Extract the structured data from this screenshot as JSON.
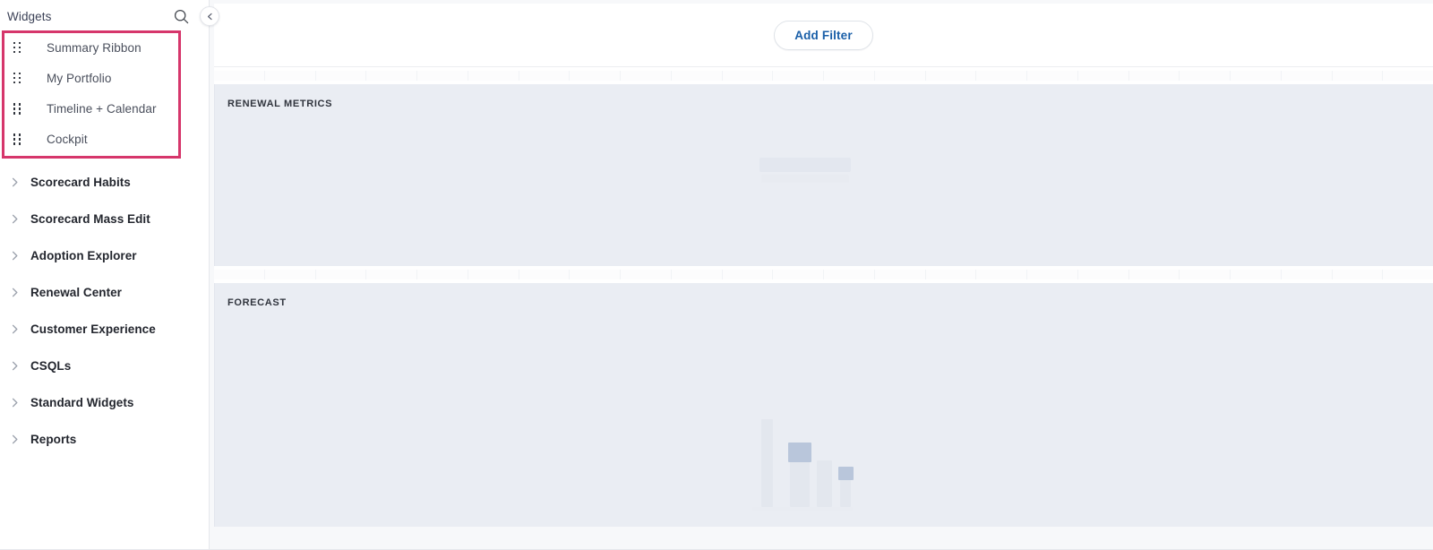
{
  "sidebar": {
    "title": "Widgets",
    "search_icon": "search-icon",
    "collapse_icon": "chevron-left-icon",
    "widgets": [
      {
        "label": "Summary Ribbon",
        "handle_icon": "drag-handle-icon"
      },
      {
        "label": "My Portfolio",
        "handle_icon": "drag-handle-icon"
      },
      {
        "label": "Timeline + Calendar",
        "handle_icon": "drag-handle-icon"
      },
      {
        "label": "Cockpit",
        "handle_icon": "drag-handle-icon"
      }
    ],
    "groups": [
      {
        "label": "Scorecard Habits",
        "chevron_icon": "chevron-right-icon"
      },
      {
        "label": "Scorecard Mass Edit",
        "chevron_icon": "chevron-right-icon"
      },
      {
        "label": "Adoption Explorer",
        "chevron_icon": "chevron-right-icon"
      },
      {
        "label": "Renewal Center",
        "chevron_icon": "chevron-right-icon"
      },
      {
        "label": "Customer Experience",
        "chevron_icon": "chevron-right-icon"
      },
      {
        "label": "CSQLs",
        "chevron_icon": "chevron-right-icon"
      },
      {
        "label": "Standard Widgets",
        "chevron_icon": "chevron-right-icon"
      },
      {
        "label": "Reports",
        "chevron_icon": "chevron-right-icon"
      }
    ]
  },
  "annotation": {
    "color": "#d6366b",
    "target": "widget-drag-list"
  },
  "toolbar": {
    "add_filter_label": "Add Filter",
    "add_filter_color": "#1a5fa8"
  },
  "panels": [
    {
      "title": "RENEWAL METRICS",
      "state": "loading",
      "placeholder": "text-skeleton"
    },
    {
      "title": "FORECAST",
      "state": "loading",
      "placeholder": "bar-chart-skeleton"
    }
  ],
  "colors": {
    "panel_background": "#eaedf3",
    "canvas_background": "#f7f8fa",
    "sidebar_background": "#ffffff",
    "accent_red": "#d6366b",
    "accent_blue": "#1a5fa8"
  }
}
